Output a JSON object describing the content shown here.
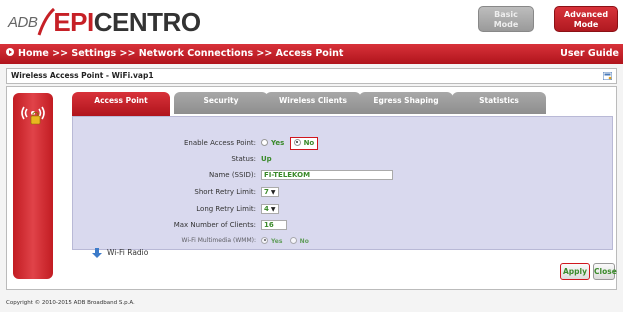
{
  "brand": {
    "prefix": "ADB",
    "name_red": "EPI",
    "name_dark": "CENTRO",
    "accent_color": "#c62026"
  },
  "mode": {
    "basic_label_1": "Basic",
    "basic_label_2": "Mode",
    "advanced_label_1": "Advanced",
    "advanced_label_2": "Mode"
  },
  "nav": {
    "breadcrumb": "Home >> Settings >> Network Connections >> Access Point",
    "user_guide": "User Guide"
  },
  "section": {
    "title": "Wireless Access Point - WiFi.vap1"
  },
  "tabs": [
    {
      "label": "Access Point",
      "active": true
    },
    {
      "label": "Security",
      "active": false
    },
    {
      "label": "Wireless Clients",
      "active": false
    },
    {
      "label": "Egress Shaping",
      "active": false
    },
    {
      "label": "Statistics",
      "active": false
    }
  ],
  "form": {
    "enable_ap": {
      "label": "Enable Access Point:",
      "yes": "Yes",
      "no": "No",
      "selected": "No"
    },
    "status": {
      "label": "Status:",
      "value": "Up"
    },
    "ssid": {
      "label": "Name (SSID):",
      "value": "FI-TELEKOM"
    },
    "short_retry": {
      "label": "Short Retry Limit:",
      "value": "7"
    },
    "long_retry": {
      "label": "Long Retry Limit:",
      "value": "4"
    },
    "max_clients": {
      "label": "Max Number of Clients:",
      "value": "16"
    },
    "wmm": {
      "label": "Wi-Fi Multimedia (WMM):",
      "yes": "Yes",
      "no": "No",
      "selected": "Yes"
    }
  },
  "link": {
    "wifi_radio": "Wi-Fi Radio"
  },
  "buttons": {
    "apply": "Apply",
    "close": "Close"
  },
  "footer": {
    "copyright": "Copyright © 2010-2015 ADB Broadband S.p.A."
  },
  "icons": {
    "nav_arrow": "play-circle-icon",
    "help": "help-icon",
    "wifi_lock": "wifi-lock-icon",
    "wifi_radio": "arrow-down-icon"
  }
}
